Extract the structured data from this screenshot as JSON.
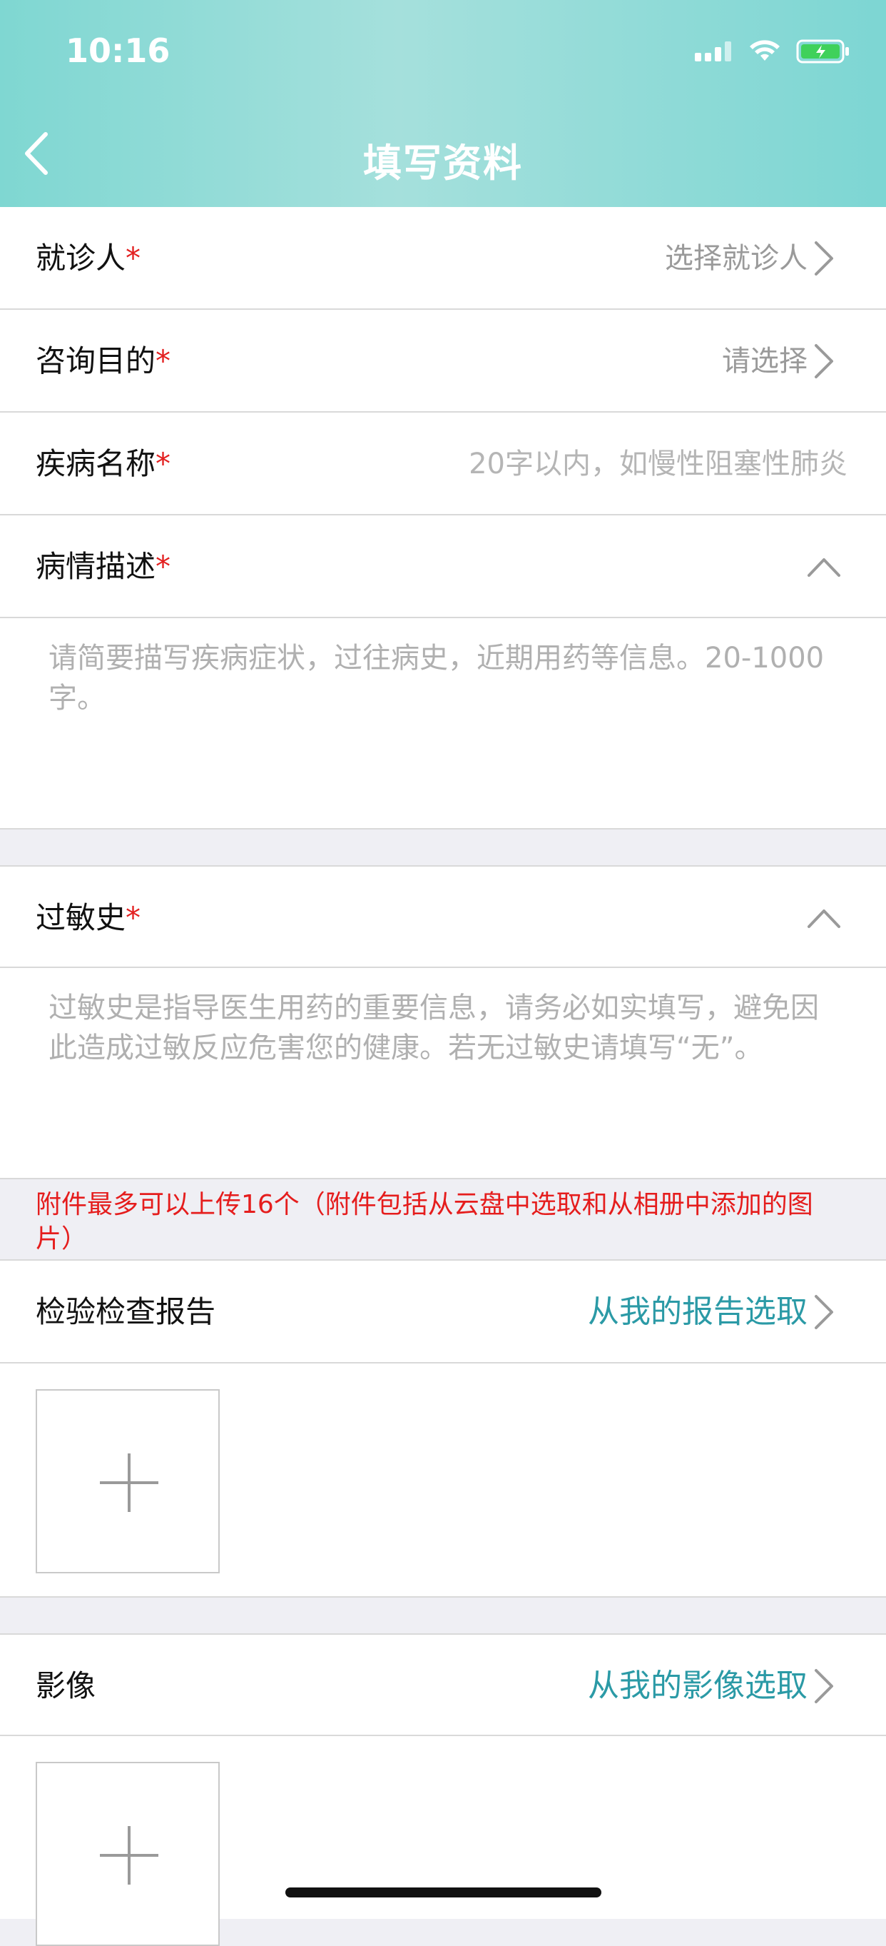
{
  "status_bar": {
    "time": "10:16"
  },
  "nav": {
    "title": "填写资料"
  },
  "form": {
    "patient": {
      "label": "就诊人",
      "required": "*",
      "value": "选择就诊人"
    },
    "purpose": {
      "label": "咨询目的",
      "required": "*",
      "value": "请选择"
    },
    "disease": {
      "label": "疾病名称",
      "required": "*",
      "placeholder": "20字以内，如慢性阻塞性肺炎"
    },
    "description": {
      "label": "病情描述",
      "required": "*",
      "placeholder": "请简要描写疾病症状，过往病史，近期用药等信息。20-1000字。"
    },
    "allergy": {
      "label": "过敏史",
      "required": "*",
      "placeholder": "过敏史是指导医生用药的重要信息，请务必如实填写，避免因此造成过敏反应危害您的健康。若无过敏史请填写“无”。"
    }
  },
  "notice": "附件最多可以上传16个（附件包括从云盘中选取和从相册中添加的图片）",
  "reports": {
    "label": "检验检查报告",
    "action": "从我的报告选取"
  },
  "imaging": {
    "label": "影像",
    "action": "从我的影像选取"
  },
  "colors": {
    "accent_teal": "#2b9aa6",
    "required_red": "#e32020",
    "header_gradient": "#8fdbd6"
  }
}
